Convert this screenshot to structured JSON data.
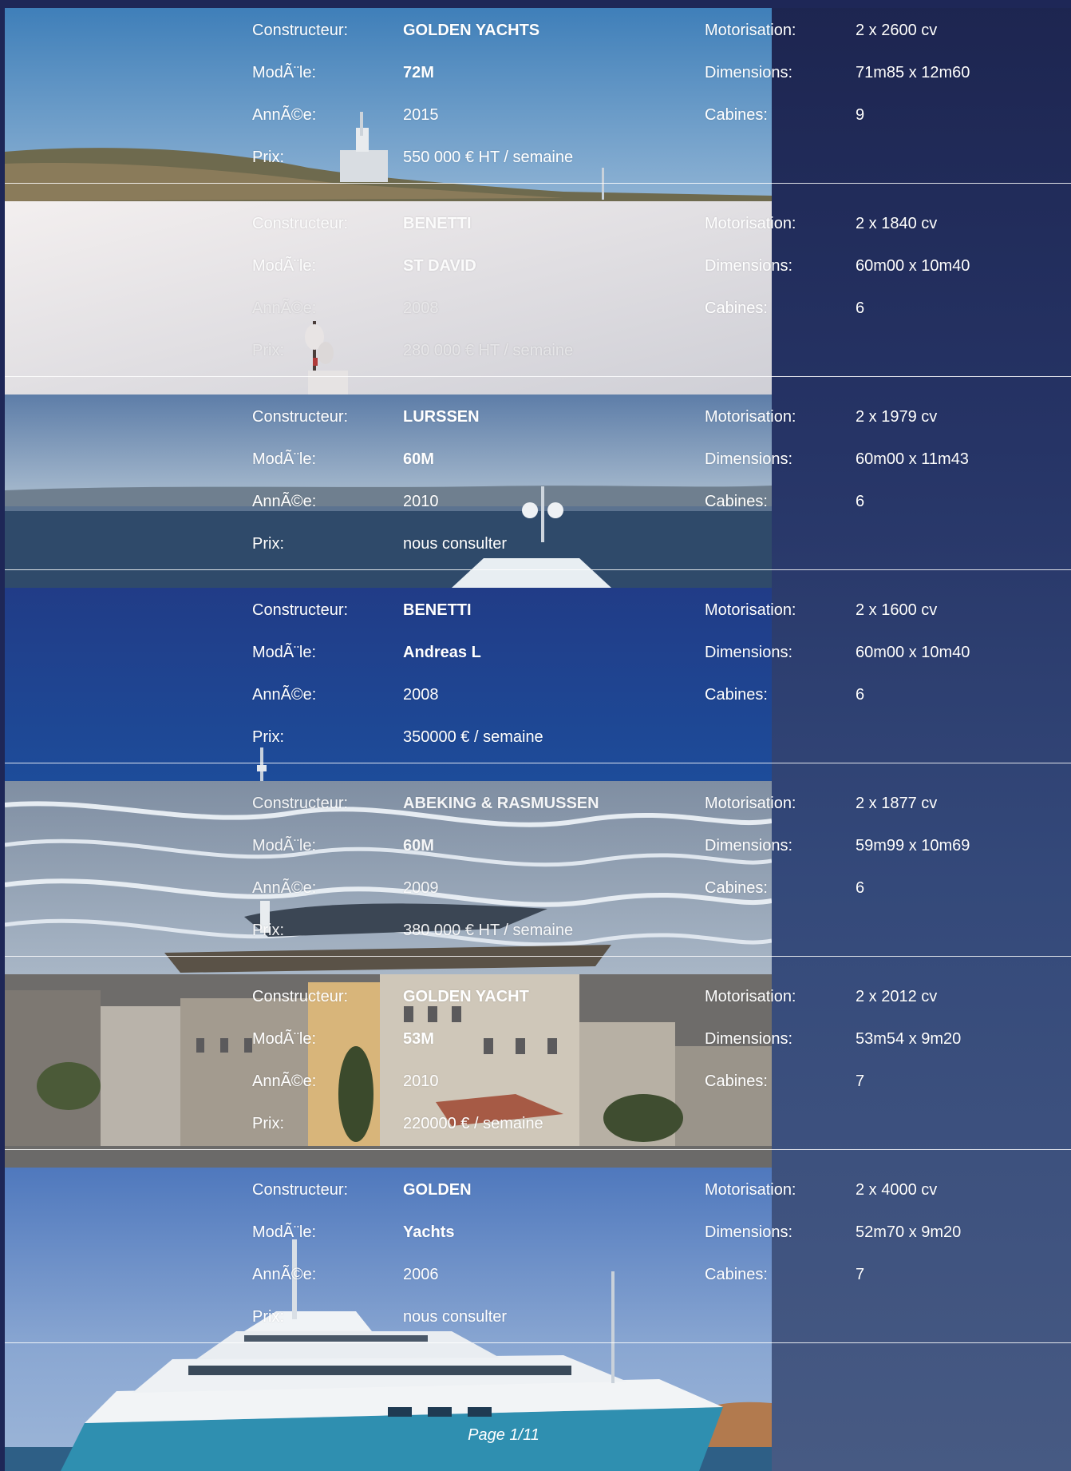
{
  "labels": {
    "builder": "Constructeur:",
    "model": "ModÃ¨le:",
    "year": "AnnÃ©e:",
    "price": "Prix:",
    "engine": "Motorisation:",
    "dimensions": "Dimensions:",
    "cabins": "Cabines:"
  },
  "listings": [
    {
      "builder": "GOLDEN YACHTS",
      "model": "72M",
      "year": "2015",
      "price": "550 000 € HT / semaine",
      "engine": "2 x 2600 cv",
      "dimensions": "71m85 x 12m60",
      "cabins": "9"
    },
    {
      "builder": "BENETTI",
      "model": "ST DAVID",
      "year": "2008",
      "price": "280 000 € HT / semaine",
      "engine": "2 x 1840 cv",
      "dimensions": "60m00 x 10m40",
      "cabins": "6"
    },
    {
      "builder": "LURSSEN",
      "model": "60M",
      "year": "2010",
      "price": "nous consulter",
      "engine": "2 x 1979 cv",
      "dimensions": "60m00 x 11m43",
      "cabins": "6"
    },
    {
      "builder": "BENETTI",
      "model": "Andreas L",
      "year": "2008",
      "price": "350000 € / semaine",
      "engine": "2 x 1600 cv",
      "dimensions": "60m00 x 10m40",
      "cabins": "6"
    },
    {
      "builder": "ABEKING & RASMUSSEN",
      "model": "60M",
      "year": "2009",
      "price": "380 000 € HT / semaine",
      "engine": "2 x 1877 cv",
      "dimensions": "59m99 x 10m69",
      "cabins": "6"
    },
    {
      "builder": "GOLDEN YACHT",
      "model": "53M",
      "year": "2010",
      "price": "220000 € / semaine",
      "engine": "2 x 2012 cv",
      "dimensions": "53m54 x 9m20",
      "cabins": "7"
    },
    {
      "builder": "GOLDEN",
      "model": "Yachts",
      "year": "2006",
      "price": "nous consulter",
      "engine": "2 x 4000 cv",
      "dimensions": "52m70 x 9m20",
      "cabins": "7"
    }
  ],
  "footer": {
    "page": "Page 1/11"
  }
}
